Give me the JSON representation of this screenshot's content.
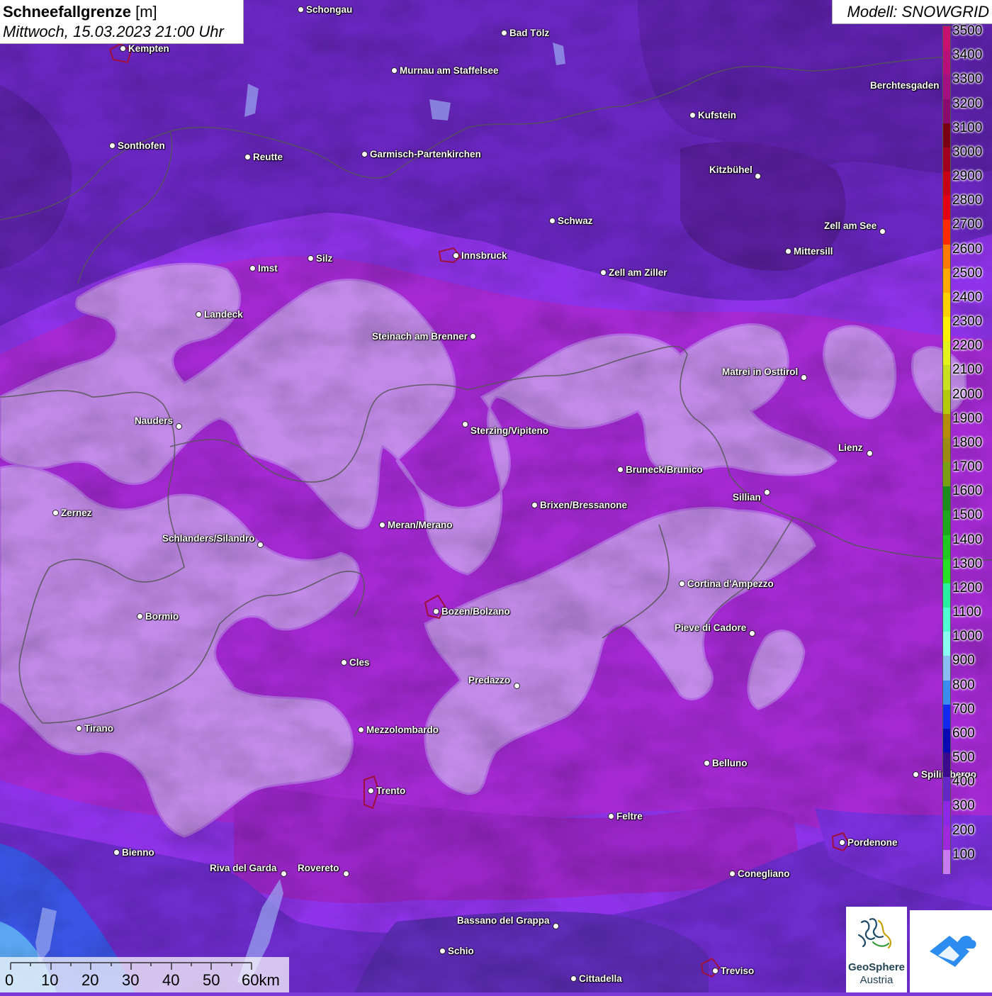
{
  "title": {
    "variable": "Schneefallgrenze",
    "unit": "[m]",
    "datetime": "Mittwoch, 15.03.2023 21:00 Uhr"
  },
  "model": "Modell: SNOWGRID",
  "legend": {
    "labels": [
      "3500",
      "3400",
      "3300",
      "3200",
      "3100",
      "3000",
      "2900",
      "2800",
      "2700",
      "2600",
      "2500",
      "2400",
      "2300",
      "2200",
      "2100",
      "2000",
      "1900",
      "1800",
      "1700",
      "1600",
      "1500",
      "1400",
      "1300",
      "1200",
      "1100",
      "1000",
      "900",
      "800",
      "700",
      "600",
      "500",
      "400",
      "300",
      "200",
      "100"
    ],
    "colors": [
      "#c8106e",
      "#b80f7a",
      "#a40f82",
      "#8c0b6e",
      "#7a0014",
      "#a0001e",
      "#c80018",
      "#e30012",
      "#ff2a00",
      "#ff7a00",
      "#ffa800",
      "#ffd000",
      "#fff000",
      "#e3f21a",
      "#c8e01e",
      "#b6c80a",
      "#b48c0a",
      "#9c8a14",
      "#7a9e14",
      "#1e8c1e",
      "#1ea81e",
      "#22c822",
      "#28e028",
      "#28f0a0",
      "#50fcd2",
      "#8afcfa",
      "#8cbcf8",
      "#3c8cf0",
      "#1428f0",
      "#0a0ab4",
      "#3c0a8c",
      "#6428c8",
      "#8c28e6",
      "#a028dc",
      "#c87af0"
    ]
  },
  "cities": [
    {
      "name": "Schongau"
    },
    {
      "name": "Bad Tölz"
    },
    {
      "name": "Kempten"
    },
    {
      "name": "Murnau am Staffelsee"
    },
    {
      "name": "Berchtesgaden"
    },
    {
      "name": "Kufstein"
    },
    {
      "name": "Sonthofen"
    },
    {
      "name": "Reutte"
    },
    {
      "name": "Garmisch-Partenkirchen"
    },
    {
      "name": "Kitzbühel"
    },
    {
      "name": "Schwaz"
    },
    {
      "name": "Zell am See"
    },
    {
      "name": "Mittersill"
    },
    {
      "name": "Innsbruck"
    },
    {
      "name": "Imst"
    },
    {
      "name": "Silz"
    },
    {
      "name": "Zell am Ziller"
    },
    {
      "name": "Landeck"
    },
    {
      "name": "Steinach am Brenner"
    },
    {
      "name": "Matrei in Osttirol"
    },
    {
      "name": "Nauders"
    },
    {
      "name": "Sterzing/Vipiteno"
    },
    {
      "name": "Lienz"
    },
    {
      "name": "Bruneck/Brunico"
    },
    {
      "name": "Sillian"
    },
    {
      "name": "Brixen/Bressanone"
    },
    {
      "name": "Zernez"
    },
    {
      "name": "Meran/Merano"
    },
    {
      "name": "Schlanders/Silandro"
    },
    {
      "name": "Cortina d'Ampezzo"
    },
    {
      "name": "Bozen/Bolzano"
    },
    {
      "name": "Bormio"
    },
    {
      "name": "Pieve di Cadore"
    },
    {
      "name": "Cles"
    },
    {
      "name": "Predazzo"
    },
    {
      "name": "Tirano"
    },
    {
      "name": "Mezzolombardo"
    },
    {
      "name": "Belluno"
    },
    {
      "name": "Spilimbergo"
    },
    {
      "name": "Trento"
    },
    {
      "name": "Feltre"
    },
    {
      "name": "Pordenone"
    },
    {
      "name": "Bienno"
    },
    {
      "name": "Riva del Garda"
    },
    {
      "name": "Rovereto"
    },
    {
      "name": "Conegliano"
    },
    {
      "name": "Bassano del Grappa"
    },
    {
      "name": "Schio"
    },
    {
      "name": "Treviso"
    },
    {
      "name": "Cittadella"
    }
  ],
  "scale": {
    "ticks": [
      "0",
      "10",
      "20",
      "30",
      "40",
      "50",
      "60km"
    ]
  },
  "logos": {
    "geosphere_line1": "GeoSphere",
    "geosphere_line2": "Austria"
  }
}
